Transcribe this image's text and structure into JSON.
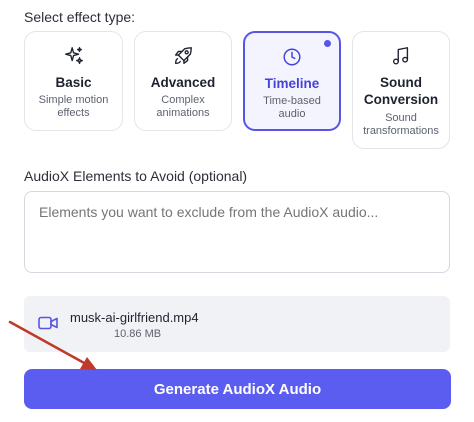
{
  "effect_section": {
    "label": "Select effect type:",
    "cards": [
      {
        "id": "basic",
        "title": "Basic",
        "description": "Simple motion effects",
        "icon": "sparkles-icon",
        "selected": false
      },
      {
        "id": "advanced",
        "title": "Advanced",
        "description": "Complex animations",
        "icon": "rocket-icon",
        "selected": false
      },
      {
        "id": "timeline",
        "title": "Timeline",
        "description": "Time-based audio",
        "icon": "clock-icon",
        "selected": true
      },
      {
        "id": "sound",
        "title": "Sound Conversion",
        "description": "Sound transformations",
        "icon": "music-note-icon",
        "selected": false
      }
    ]
  },
  "avoid_section": {
    "label": "AudioX Elements to Avoid (optional)",
    "placeholder": "Elements you want to exclude from the AudioX audio..."
  },
  "file": {
    "name": "musk-ai-girlfriend.mp4",
    "size": "10.86 MB",
    "icon": "video-camera-icon"
  },
  "generate_button": {
    "label": "Generate AudioX Audio"
  },
  "colors": {
    "accent": "#5b5cf0",
    "selected_border": "#5855e6",
    "annotation_arrow": "#c0392b"
  }
}
